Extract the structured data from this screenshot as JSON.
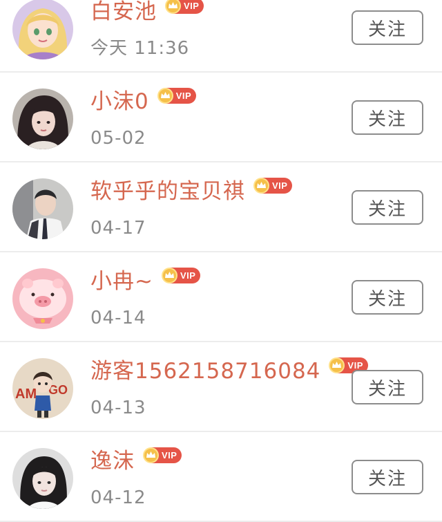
{
  "follow_list": {
    "items": [
      {
        "name": "白安池",
        "vip_label": "VIP",
        "date": "今天 11:36",
        "follow_label": "关注",
        "avatar_icon": "cartoon-princess-avatar"
      },
      {
        "name": "小沫0",
        "vip_label": "VIP",
        "date": "05-02",
        "follow_label": "关注",
        "avatar_icon": "girl-photo-avatar"
      },
      {
        "name": "软乎乎的宝贝祺",
        "vip_label": "VIP",
        "date": "04-17",
        "follow_label": "关注",
        "avatar_icon": "boy-uniform-photo-avatar"
      },
      {
        "name": "小冉~",
        "vip_label": "VIP",
        "date": "04-14",
        "follow_label": "关注",
        "avatar_icon": "pink-pig-avatar"
      },
      {
        "name": "游客1562158716084",
        "vip_label": "VIP",
        "date": "04-13",
        "follow_label": "关注",
        "avatar_icon": "cartoon-boy-amigo-avatar"
      },
      {
        "name": "逸沫",
        "vip_label": "VIP",
        "date": "04-12",
        "follow_label": "关注",
        "avatar_icon": "girl-selfie-avatar"
      }
    ]
  },
  "colors": {
    "name": "#d5674f",
    "vip_badge": "#e55447",
    "crown": "#f5c04a",
    "date": "#8a8a8a",
    "button_border": "#8c8c8c",
    "divider": "#ececec"
  }
}
